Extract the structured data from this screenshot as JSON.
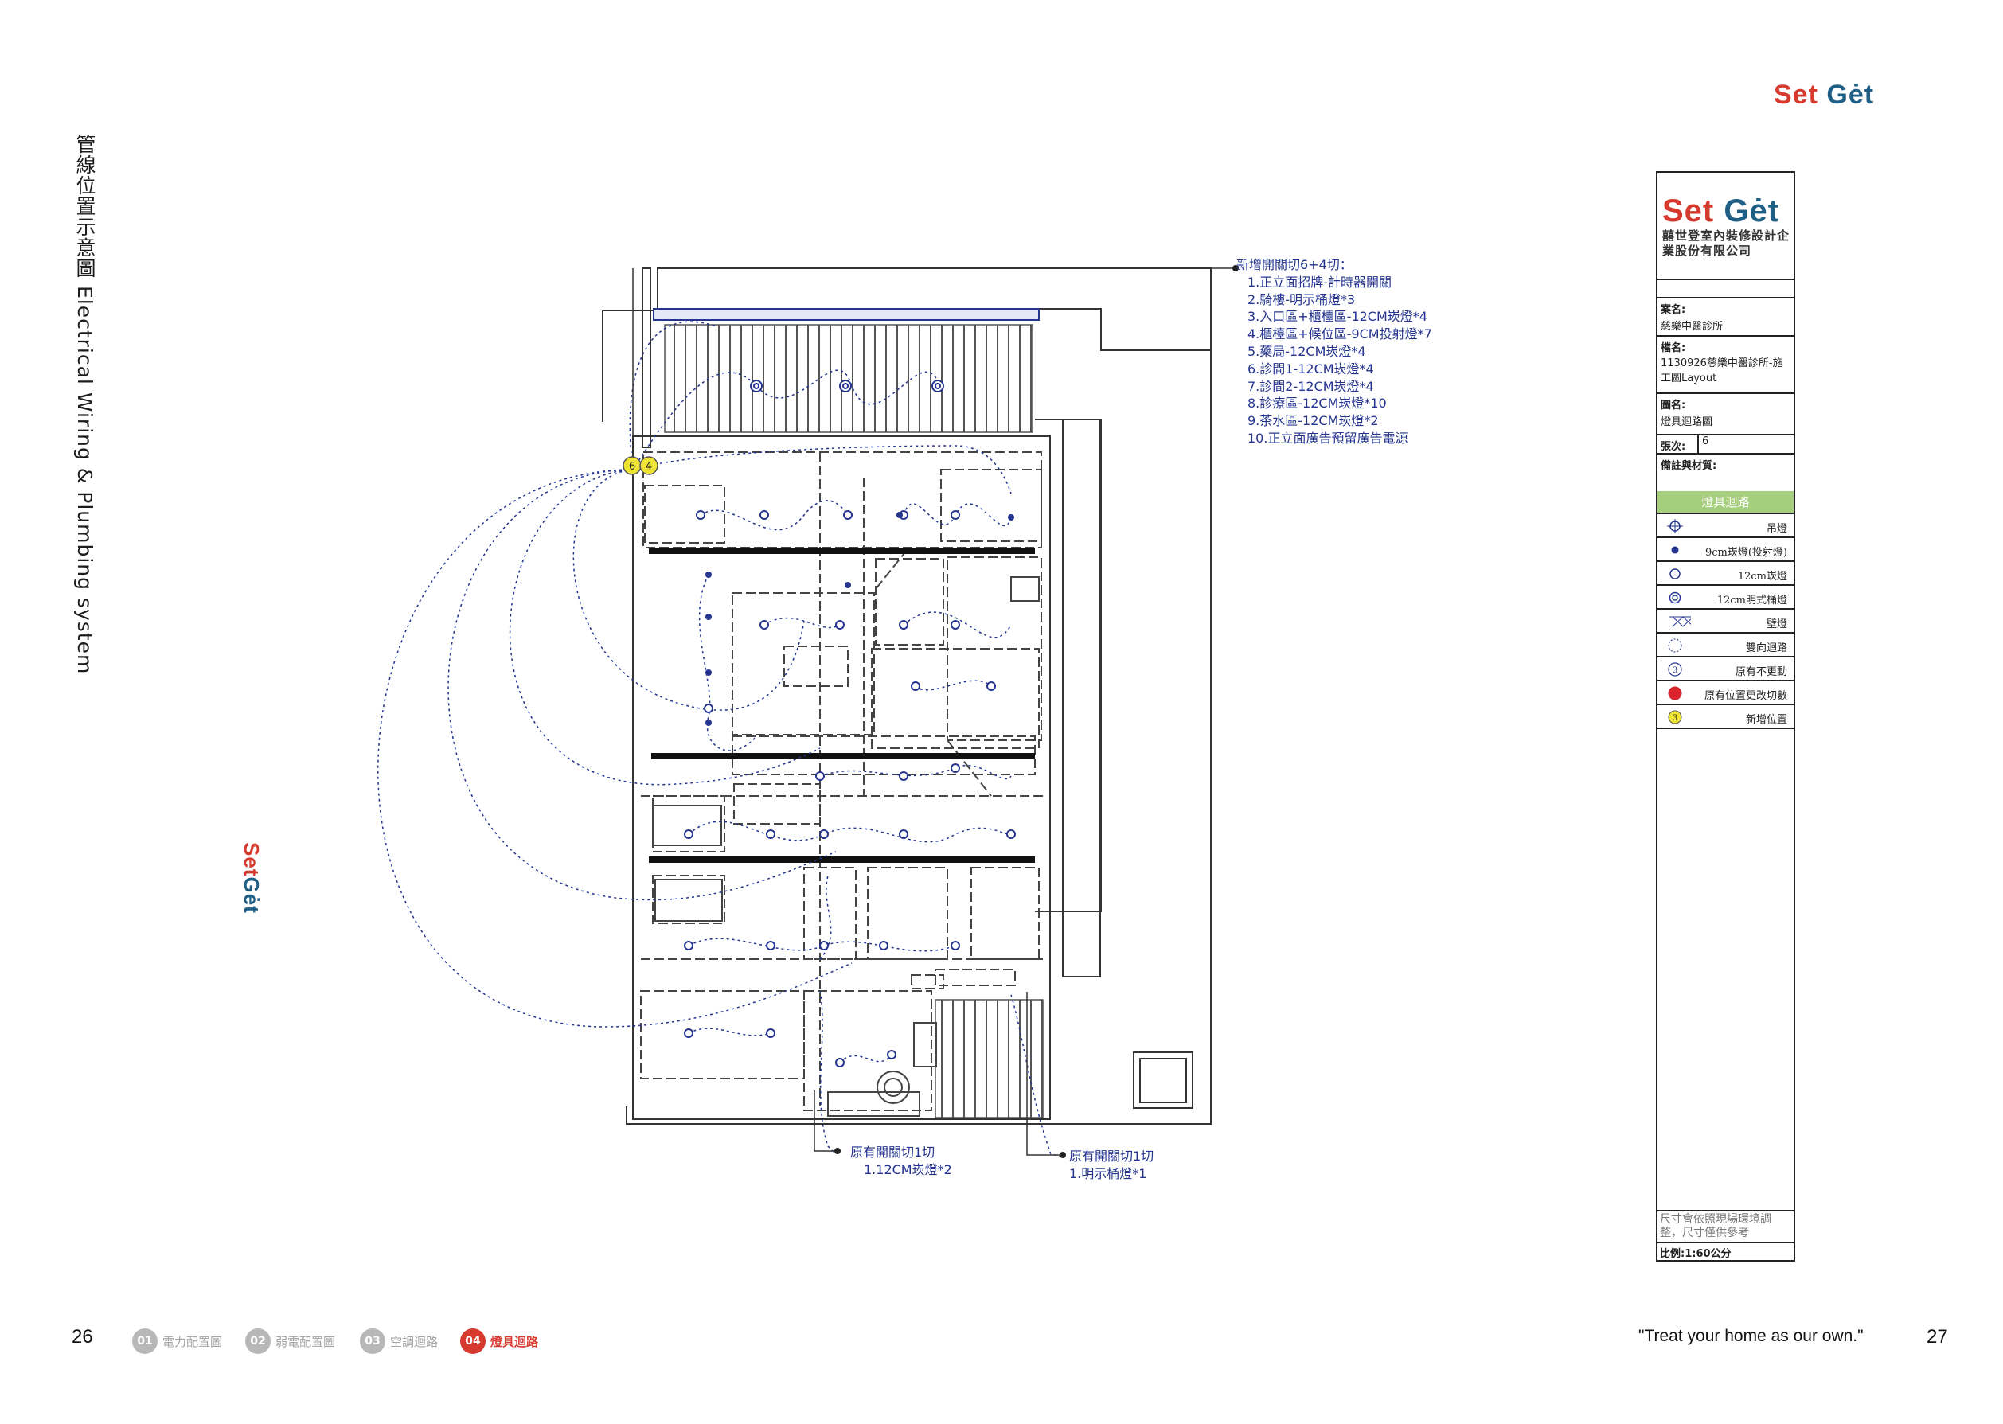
{
  "brand": {
    "logo_set": "Set",
    "logo_get": "Gėt"
  },
  "side_title": "管線位置示意圖  Electrical Wiring & Plumbing system",
  "notes": {
    "heading": "新增開關切6+4切：",
    "items": [
      "1.正立面招牌-計時器開關",
      "2.騎樓-明示桶燈*3",
      "3.入口區+櫃檯區-12CM崁燈*4",
      "4.櫃檯區+候位區-9CM投射燈*7",
      "5.藥局-12CM崁燈*4",
      "6.診間1-12CM崁燈*4",
      "7.診間2-12CM崁燈*4",
      "8.診療區-12CM崁燈*10",
      "9.茶水區-12CM崁燈*2",
      "10.正立面廣告預留廣告電源"
    ]
  },
  "callout_left": {
    "line1": "原有開關切1切",
    "line2": "1.12CM崁燈*2"
  },
  "callout_right": {
    "line1": "原有開關切1切",
    "line2": "1.明示桶燈*1"
  },
  "markers": {
    "a": "6",
    "b": "4"
  },
  "title_block": {
    "company": "囍世登室內裝修設計企業股份有限公司",
    "project_label": "案名:",
    "project_value": "慈樂中醫診所",
    "file_label": "檔名:",
    "file_value": "1130926慈樂中醫診所-施工圖Layout",
    "drawing_label": "圖名:",
    "drawing_value": "燈具迴路圖",
    "sheet_label": "張次:",
    "sheet_value": "6",
    "remark_label": "備註與材質:",
    "legend_title": "燈具迴路",
    "legend": [
      {
        "icon": "pendant-lamp-icon",
        "label": "吊燈"
      },
      {
        "icon": "spot-9cm-icon",
        "label": "9cm崁燈(投射燈)"
      },
      {
        "icon": "downlight-12cm-icon",
        "label": "12cm崁燈"
      },
      {
        "icon": "can-light-12cm-icon",
        "label": "12cm明式桶燈"
      },
      {
        "icon": "wall-lamp-icon",
        "label": "壁燈"
      },
      {
        "icon": "two-way-circuit-icon",
        "label": "雙向迴路"
      },
      {
        "icon": "existing-unchanged-icon",
        "label": "原有不更動",
        "num": "3"
      },
      {
        "icon": "existing-relocated-icon",
        "label": "原有位置更改切數"
      },
      {
        "icon": "new-position-icon",
        "label": "新增位置",
        "num": "3"
      }
    ],
    "disclaimer": "尺寸會依照現場環境調整，尺寸僅供參考",
    "scale": "比例:1:60公分"
  },
  "footer": {
    "page_left": "26",
    "page_right": "27",
    "quote": "\"Treat your home as our own.\"",
    "tabs": [
      {
        "num": "01",
        "label": "電力配置圖"
      },
      {
        "num": "02",
        "label": "弱電配置圖"
      },
      {
        "num": "03",
        "label": "空調迴路"
      },
      {
        "num": "04",
        "label": "燈具迴路"
      }
    ]
  },
  "colors": {
    "accent": "#d63a2f",
    "brand_blue": "#1f5f86",
    "circuit": "#24348f",
    "legend_green": "#a5cf7d",
    "new_marker": "#f0e535"
  }
}
